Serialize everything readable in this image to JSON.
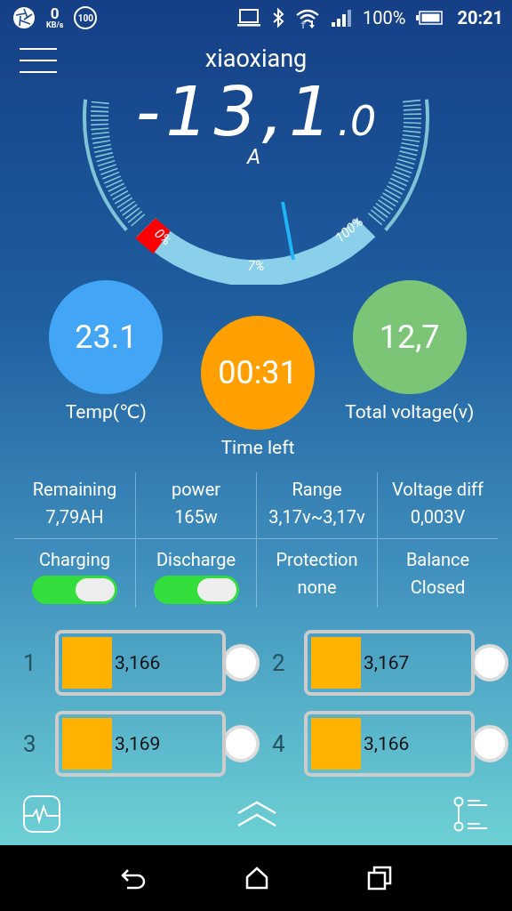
{
  "status_bar": {
    "speed": "0",
    "speed_unit": "KB/s",
    "badge": "100",
    "battery": "100%",
    "time": "20:21"
  },
  "header": {
    "title": "xiaoxiang"
  },
  "gauge": {
    "current": "-13,1",
    "decimal": ".0",
    "unit": "A",
    "scale_labels": [
      "0%",
      "7%",
      "100%"
    ]
  },
  "stats": [
    {
      "value": "23.1",
      "label": "Temp(℃)",
      "color": "#42a5f5"
    },
    {
      "value": "00:31",
      "label": "Time left",
      "color": "#ffa000"
    },
    {
      "value": "12,7",
      "label": "Total voltage(v)",
      "color": "#7cc576"
    }
  ],
  "info": [
    {
      "label": "Remaining",
      "value": "7,79AH"
    },
    {
      "label": "power",
      "value": "165w"
    },
    {
      "label": "Range",
      "value": "3,17v~3,17v"
    },
    {
      "label": "Voltage diff",
      "value": "0,003V"
    }
  ],
  "switches": [
    {
      "kind": "toggle",
      "label": "Charging",
      "on": true
    },
    {
      "kind": "toggle",
      "label": "Discharge",
      "on": true
    },
    {
      "kind": "text",
      "label": "Protection",
      "value": "none"
    },
    {
      "kind": "text",
      "label": "Balance",
      "value": "Closed"
    }
  ],
  "cells": [
    {
      "number": "1",
      "voltage": "3,166",
      "balancing": false
    },
    {
      "number": "2",
      "voltage": "3,167",
      "balancing": false
    },
    {
      "number": "3",
      "voltage": "3,169",
      "balancing": false
    },
    {
      "number": "4",
      "voltage": "3,166",
      "balancing": false
    }
  ]
}
